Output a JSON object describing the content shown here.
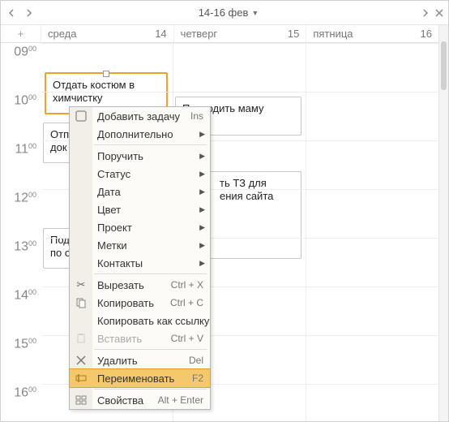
{
  "header": {
    "date_range": "14-16 фев"
  },
  "days": [
    {
      "name": "среда",
      "num": "14"
    },
    {
      "name": "четверг",
      "num": "15"
    },
    {
      "name": "пятница",
      "num": "16"
    }
  ],
  "hours": [
    "09",
    "10",
    "11",
    "12",
    "13",
    "14",
    "15",
    "16"
  ],
  "hour_suffix": "00",
  "events": {
    "e1": "Отдать костюм в химчистку",
    "e2": "Отправить документы",
    "e3": "Подумать, куда поехать по отпуску",
    "e4": "Проводить маму",
    "e5": "Составить ТЗ для ведения сайта"
  },
  "menu": {
    "add_task": {
      "label": "Добавить задачу",
      "shortcut": "Ins"
    },
    "additional": {
      "label": "Дополнительно"
    },
    "assign": {
      "label": "Поручить"
    },
    "status": {
      "label": "Статус"
    },
    "date": {
      "label": "Дата"
    },
    "color": {
      "label": "Цвет"
    },
    "project": {
      "label": "Проект"
    },
    "tags": {
      "label": "Метки"
    },
    "contacts": {
      "label": "Контакты"
    },
    "cut": {
      "label": "Вырезать",
      "shortcut": "Ctrl + X"
    },
    "copy": {
      "label": "Копировать",
      "shortcut": "Ctrl + C"
    },
    "copy_link": {
      "label": "Копировать как ссылку"
    },
    "paste": {
      "label": "Вставить",
      "shortcut": "Ctrl + V"
    },
    "delete": {
      "label": "Удалить",
      "shortcut": "Del"
    },
    "rename": {
      "label": "Переименовать",
      "shortcut": "F2"
    },
    "properties": {
      "label": "Свойства",
      "shortcut": "Alt + Enter"
    }
  }
}
